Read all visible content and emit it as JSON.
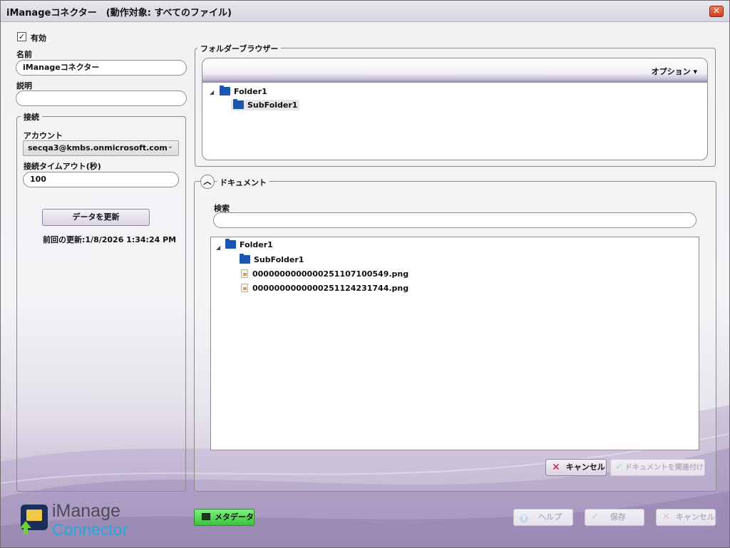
{
  "window": {
    "title": "iManageコネクター　(動作対象: すべてのファイル)",
    "close_glyph": "✕"
  },
  "left": {
    "enabled_label": "有効",
    "enabled_checked": true,
    "name_label": "名前",
    "name_value": "iManageコネクター",
    "description_label": "説明",
    "description_value": "",
    "connection_group": "接続",
    "account_label": "アカウント",
    "account_value": "secqa3@kmbs.onmicrosoft.com",
    "timeout_label": "接続タイムアウト(秒)",
    "timeout_value": "100",
    "refresh_button": "データを更新",
    "last_update": "前回の更新:1/8/2026 1:34:24 PM"
  },
  "folder_browser": {
    "group_title": "フォルダーブラウザー",
    "options_label": "オプション ▾",
    "tree": [
      {
        "label": "Folder1",
        "expanded": true,
        "indent": 0
      },
      {
        "label": "SubFolder1",
        "indent": 1,
        "selected": true
      }
    ]
  },
  "documents": {
    "group_title": "ドキュメント",
    "collapse_glyph": "︿",
    "search_label": "検索",
    "search_value": "",
    "tree": [
      {
        "label": "Folder1",
        "type": "folder",
        "expanded": true
      },
      {
        "label": "SubFolder1",
        "type": "folder"
      },
      {
        "label": "0000000000000251107100549.png",
        "type": "file"
      },
      {
        "label": "0000000000000251124231744.png",
        "type": "file"
      }
    ],
    "cancel_button": "キャンセル",
    "link_button": "ドキュメントを関連付け"
  },
  "footer": {
    "logo_line1": "iManage",
    "logo_line2": "Connector",
    "metadata_button": "メタデータ",
    "help_button": "ヘルプ",
    "save_button": "保存",
    "cancel_button": "キャンセル"
  },
  "colors": {
    "accent_purple": "#8f7faa",
    "folder_blue": "#1a55b0",
    "metadata_green": "#3cc23c",
    "cancel_red": "#c8102e"
  }
}
